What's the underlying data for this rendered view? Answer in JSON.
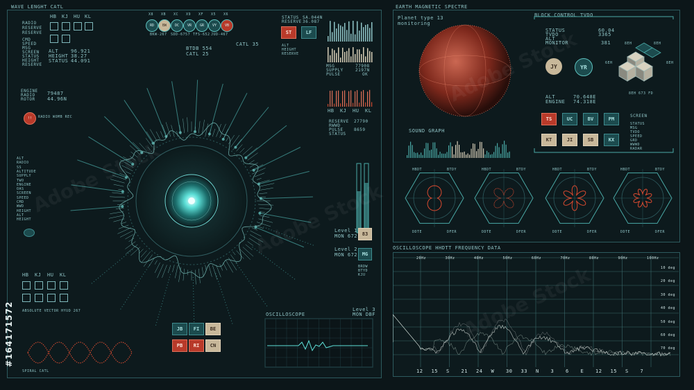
{
  "left": {
    "title": "WAVE LENGHT CATL",
    "codes": [
      "HB",
      "KJ",
      "HU",
      "KL"
    ],
    "list1": [
      "RADIO",
      "RESERVE",
      "RESERVE"
    ],
    "list2": [
      "CMD",
      "SPEED",
      "MSG",
      "SCREEN",
      "STATUS",
      "HEIGHT",
      "RESERVE"
    ],
    "alt_vals": [
      "ALT",
      "HEIGHT",
      "STATUS"
    ],
    "alt_nums": [
      "96.921",
      "38.27",
      "44.091"
    ],
    "engine": [
      "ENGINE",
      "RADIO",
      "ROTOR"
    ],
    "engine_nums": [
      "79487",
      "44.96N"
    ],
    "red_label": "RADIO\nWOMB\nREC",
    "mid_list": [
      "ALT",
      "RADIO",
      "SS",
      "ALTITUDE",
      "SUPPLY",
      "TWO",
      "ENGINE",
      "OAS",
      "SCREEN",
      "SPEED",
      "CMD",
      "WWD",
      "HEIGHT",
      "ALT",
      "HEIGHT"
    ],
    "codes2": [
      "HB",
      "KJ",
      "HU",
      "KL"
    ],
    "bottom_title": "ABSOLUTE VECTOR HYUD 267",
    "bottom_label": "SPIRAL CATL"
  },
  "center": {
    "top_circles": [
      "RD",
      "BW",
      "DC",
      "VR",
      "GR",
      "VY",
      "VB"
    ],
    "top_codes": [
      "X8",
      "XB",
      "XC",
      "X9",
      "XF",
      "X5",
      "X6"
    ],
    "top_nums": [
      "BKW-267",
      "SDD-6757",
      "TFS-652",
      "JUD-467"
    ],
    "btdb": "BTDB 554",
    "catl25": "CATL 25",
    "catl35": "CATL 35",
    "status_block": [
      "STATUS",
      "RESERVE"
    ],
    "status_nums": [
      "SA.044N",
      "36.087"
    ],
    "st": "ST",
    "lf": "LF",
    "alt_block": [
      "ALT",
      "HEIGHT",
      "RESERVE"
    ],
    "msg_block": [
      "MSG",
      "SUPPLY",
      "PULSE"
    ],
    "msg_nums": [
      "77908",
      "2197N",
      "OK"
    ],
    "codes3": [
      "HB",
      "KJ",
      "HU",
      "KL"
    ],
    "reserve_block": [
      "RESERVE",
      "RWWD",
      "PULSE",
      "STATUS"
    ],
    "reserve_nums": [
      "27790",
      "",
      "8659"
    ],
    "level1": "Level 1",
    "level1b": "MON 672",
    "level1v": "83",
    "level2": "Level 2",
    "level2b": "MON 672",
    "level2v": "MG",
    "level3": "Level 3",
    "level3b": "MON DBF",
    "side_small": [
      "BRDW",
      "BTYD",
      "KJU"
    ],
    "osc": "OSCILLOSCOPE",
    "grid_btns": [
      {
        "label": "JB",
        "color": "teal"
      },
      {
        "label": "FI",
        "color": "teal"
      },
      {
        "label": "BE",
        "color": "beige"
      },
      {
        "label": "PB",
        "color": "red"
      },
      {
        "label": "RI",
        "color": "red"
      },
      {
        "label": "CN",
        "color": "beige"
      }
    ]
  },
  "right_top": {
    "title": "EARTH MAGNETIC SPECTRE",
    "planet": "Planet type 13",
    "monitoring": "monitoring",
    "block": "BLOCK CONTROL TVDO",
    "status_list": [
      "STATUS",
      "TVDO",
      "ALT",
      "MONITOR"
    ],
    "status_nums": [
      "60.04",
      "3365",
      "381"
    ],
    "jy": "JY",
    "yr": "YR",
    "alt_engine": [
      "ALT",
      "ENGINE"
    ],
    "alt_nums": [
      "70.648E",
      "74.318E"
    ],
    "cube_label": "8EH 673 FD",
    "cube_tags": [
      "6EH",
      "8EH",
      "8EH",
      "8EH"
    ],
    "btns1": [
      {
        "label": "TS",
        "color": "red"
      },
      {
        "label": "UC",
        "color": "teal"
      },
      {
        "label": "BV",
        "color": "teal"
      },
      {
        "label": "PM",
        "color": "teal"
      }
    ],
    "btns2": [
      {
        "label": "KT",
        "color": "beige"
      },
      {
        "label": "JI",
        "color": "beige"
      },
      {
        "label": "SB",
        "color": "beige"
      },
      {
        "label": "KX",
        "color": "teal"
      }
    ],
    "screen_list": [
      "SCREEN",
      "STATUS",
      "MSG",
      "TVDO",
      "SPEED",
      "GRD",
      "WWWD",
      "RADAR"
    ],
    "sound": "SOUND GRAPH",
    "hex_top": [
      "HBDT",
      "BTDY"
    ],
    "hex_bot": [
      "DDTE",
      "DFER"
    ]
  },
  "right_bottom": {
    "title": "OSCILLOSCOPE HHDTT FREQUENCY DATA",
    "freqs": [
      "20Hz",
      "30Hz",
      "40Hz",
      "50Hz",
      "60Hz",
      "70Hz",
      "80Hz",
      "90Hz",
      "100Hz"
    ],
    "degs": [
      "10 deg",
      "20 deg",
      "30 deg",
      "40 deg",
      "50 deg",
      "60 deg",
      "70 deg"
    ],
    "compass": [
      "12",
      "15",
      "S",
      "21",
      "24",
      "W",
      "30",
      "33",
      "N",
      "3",
      "6",
      "E",
      "12",
      "15",
      "S",
      "7"
    ]
  },
  "watermark": {
    "brand": "Adobe Stock",
    "id": "#164171572"
  }
}
